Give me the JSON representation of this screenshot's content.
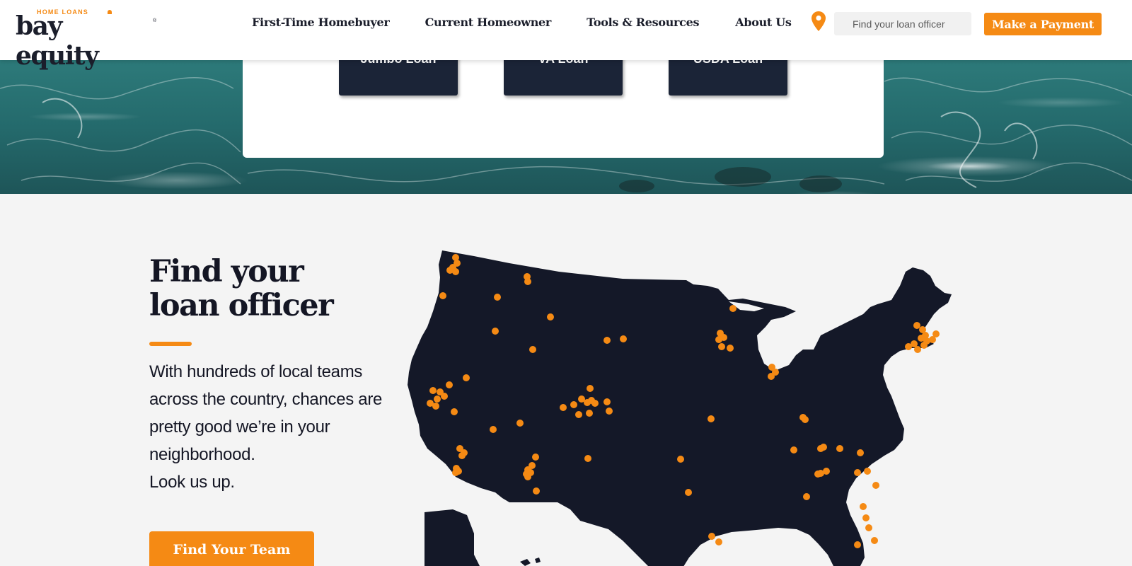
{
  "brand": {
    "logo_small": "HOME LOANS",
    "logo_main": "bay equity",
    "logo_reg": "®",
    "accent_color": "#f58a14",
    "dark_color": "#1b1e2b"
  },
  "nav": {
    "items": [
      {
        "label": "First-Time Homebuyer"
      },
      {
        "label": "Current Homeowner"
      },
      {
        "label": "Tools & Resources"
      },
      {
        "label": "About Us"
      }
    ],
    "location_icon": "map-pin-icon",
    "search_placeholder": "Find your loan officer",
    "payment_label": "Make a Payment"
  },
  "loan_types": [
    {
      "label": "Jumbo Loan"
    },
    {
      "label": "VA Loan"
    },
    {
      "label": "USDA Loan"
    }
  ],
  "section": {
    "title_lines": [
      "Find your",
      "loan officer"
    ],
    "description_lines": [
      "With hundreds of local teams",
      "across the country, chances are",
      "pretty good we’re in your",
      "neighborhood.",
      "Look us up."
    ],
    "cta_label": "Find Your Team",
    "map_color": "#141828",
    "marker_color": "#f58a14"
  }
}
